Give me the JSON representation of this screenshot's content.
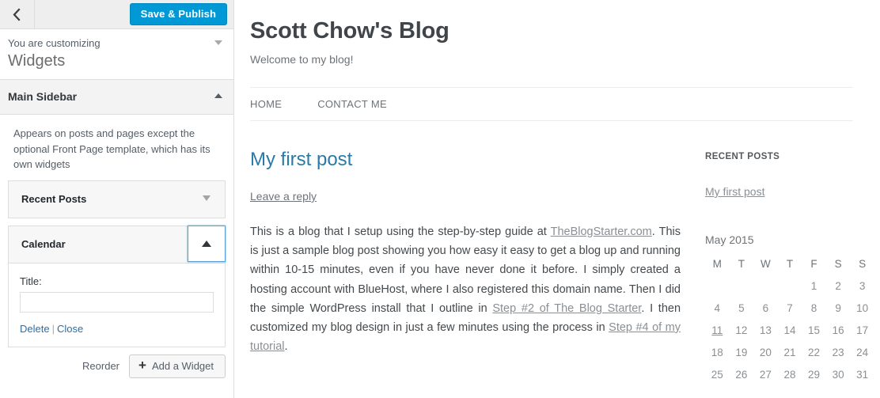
{
  "customizer": {
    "back_label": "Back",
    "back_icon": "chevron-left-icon",
    "save_label": "Save & Publish",
    "save_color": "#0099d5",
    "customizing_label": "You are customizing",
    "customizing_title": "Widgets",
    "collapse_icon": "chevron-down-icon",
    "section": {
      "title": "Main Sidebar",
      "toggle_icon": "chevron-up-icon",
      "description": "Appears on posts and pages except the optional Front Page template, which has its own widgets"
    },
    "widgets": [
      {
        "title": "Recent Posts",
        "expanded": false,
        "toggle_icon": "chevron-down-icon"
      },
      {
        "title": "Calendar",
        "expanded": true,
        "toggle_icon": "chevron-up-icon",
        "focused": true,
        "fields": {
          "title_label": "Title:",
          "title_value": "",
          "title_placeholder": ""
        },
        "actions": {
          "delete_label": "Delete",
          "separator": "|",
          "close_label": "Close"
        }
      }
    ],
    "footer": {
      "reorder_label": "Reorder",
      "add_widget_label": "Add a Widget",
      "add_widget_icon": "plus-icon"
    }
  },
  "preview": {
    "site_title": "Scott Chow's Blog",
    "site_description": "Welcome to my blog!",
    "nav": [
      {
        "label": "HOME"
      },
      {
        "label": "CONTACT ME"
      }
    ],
    "post": {
      "title": "My first post",
      "reply_link": "Leave a reply",
      "paragraph_1_part_1": "This is a blog that I setup using the step-by-step guide at ",
      "paragraph_1_link_1": "TheBlogStarter.com",
      "paragraph_1_part_2": ". This is just a sample blog post showing you how easy it easy to get a blog up and running within 10-15 minutes, even if you have never done it before. I simply created a hosting account with BlueHost, where I also registered this domain name.  Then I did the simple WordPress install that I outline in ",
      "paragraph_1_link_2": "Step #2 of The Blog Starter",
      "paragraph_1_part_3": ".  I then customized my blog design in just a few minutes using the process in ",
      "paragraph_1_link_3": "Step #4 of my tutorial",
      "paragraph_1_part_4": "."
    },
    "sidebar": {
      "recent_posts_heading": "RECENT POSTS",
      "recent_posts": [
        {
          "label": "My first post"
        }
      ],
      "calendar": {
        "caption": "May 2015",
        "weekdays": [
          "M",
          "T",
          "W",
          "T",
          "F",
          "S",
          "S"
        ],
        "today": 11,
        "weeks": [
          [
            "",
            "",
            "",
            "",
            "1",
            "2",
            "3"
          ],
          [
            "4",
            "5",
            "6",
            "7",
            "8",
            "9",
            "10"
          ],
          [
            "11",
            "12",
            "13",
            "14",
            "15",
            "16",
            "17"
          ],
          [
            "18",
            "19",
            "20",
            "21",
            "22",
            "23",
            "24"
          ],
          [
            "25",
            "26",
            "27",
            "28",
            "29",
            "30",
            "31"
          ]
        ]
      }
    }
  }
}
